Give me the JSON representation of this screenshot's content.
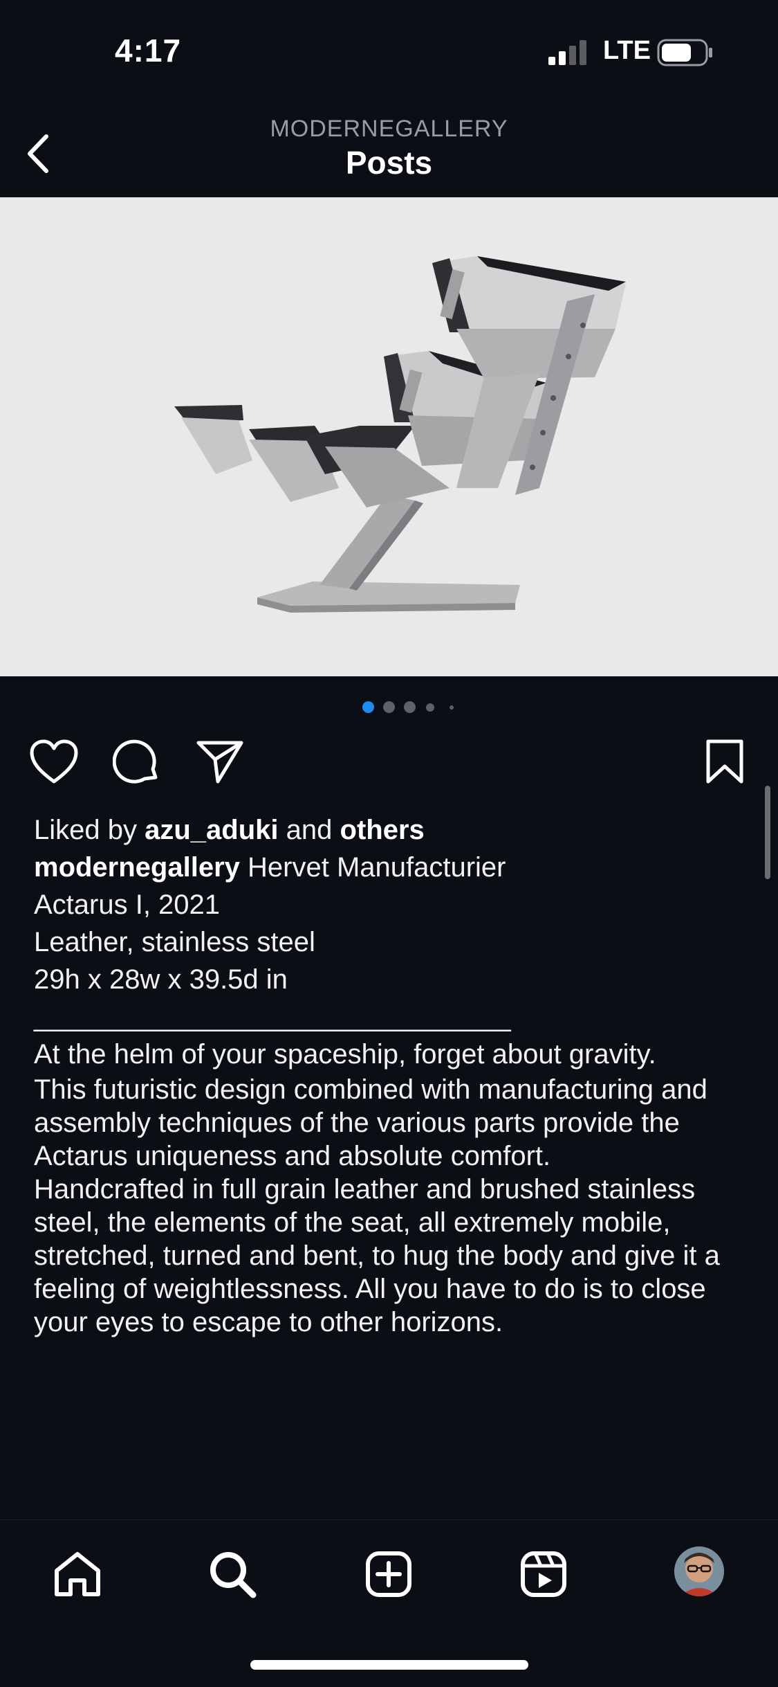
{
  "status_bar": {
    "time": "4:17",
    "network": "LTE",
    "icons": [
      "signal-icon",
      "battery-icon"
    ]
  },
  "header": {
    "account": "MODERNEGALLERY",
    "title": "Posts",
    "back_icon": "chevron-left-icon"
  },
  "post": {
    "image_description_icon": "chair-photo",
    "carousel": {
      "count": 5,
      "active_index": 0,
      "active_color": "#1d8bf0"
    },
    "actions": [
      "heart-icon",
      "comment-icon",
      "share-icon",
      "bookmark-icon"
    ],
    "likes": {
      "prefix": "Liked by",
      "user": "azu_aduki",
      "joiner": "and",
      "others": "others"
    },
    "caption": {
      "username": "modernegallery",
      "line1": "Hervet Manufacturier",
      "line2": "Actarus I, 2021",
      "line3": "Leather, stainless steel",
      "line4": "29h x 28w x 39.5d in",
      "divider": "_______________________________",
      "paragraph1": "At the helm of your spaceship, forget about gravity.",
      "paragraph2": "This futuristic design combined with manufacturing and assembly techniques of the various parts provide the Actarus uniqueness and absolute comfort.",
      "paragraph3": "Handcrafted in full grain leather and brushed stainless steel, the elements of the seat, all extremely mobile, stretched, turned and bent, to hug the body and give it a feeling of weightlessness. All you have to do is to close your eyes to escape to other horizons."
    }
  },
  "tab_bar": {
    "items": [
      "home-icon",
      "search-icon",
      "create-icon",
      "reels-icon",
      "profile-avatar"
    ]
  }
}
